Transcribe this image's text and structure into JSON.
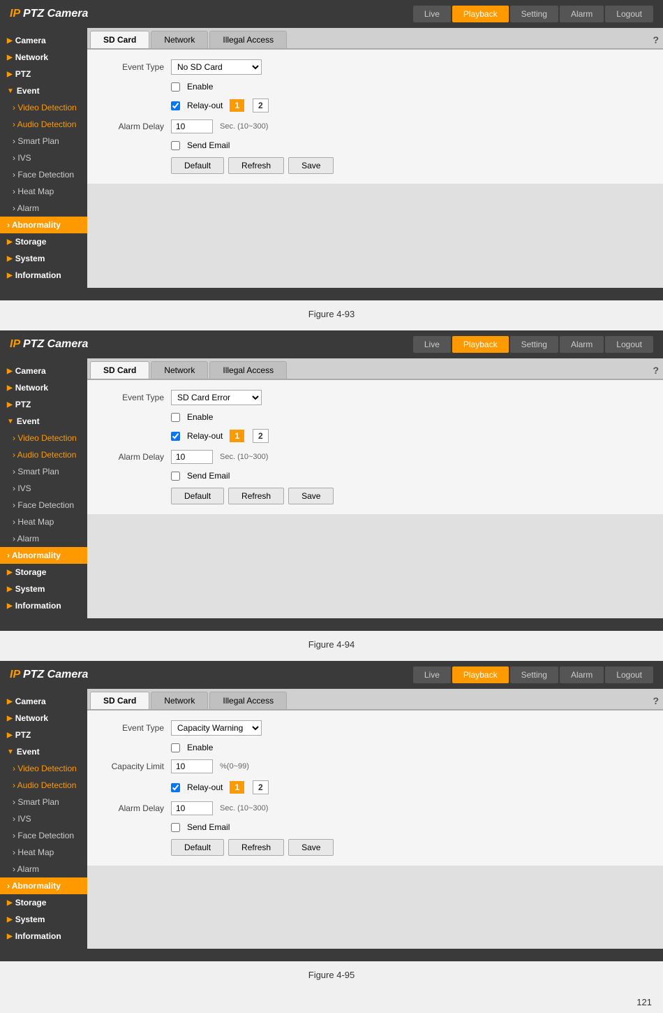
{
  "app": {
    "logo_ip": "IP",
    "logo_rest": " PTZ Camera"
  },
  "nav": {
    "buttons": [
      "Live",
      "Playback",
      "Setting",
      "Alarm",
      "Logout"
    ],
    "active": "Playback"
  },
  "sidebar": {
    "items": [
      {
        "label": "Camera",
        "type": "section"
      },
      {
        "label": "Network",
        "type": "section"
      },
      {
        "label": "PTZ",
        "type": "section"
      },
      {
        "label": "Event",
        "type": "section"
      },
      {
        "label": "Video Detection",
        "type": "sub"
      },
      {
        "label": "Audio Detection",
        "type": "sub"
      },
      {
        "label": "Smart Plan",
        "type": "sub"
      },
      {
        "label": "IVS",
        "type": "sub"
      },
      {
        "label": "Face Detection",
        "type": "sub"
      },
      {
        "label": "Heat Map",
        "type": "sub"
      },
      {
        "label": "Alarm",
        "type": "sub"
      },
      {
        "label": "Abnormality",
        "type": "sub",
        "active": true
      },
      {
        "label": "Storage",
        "type": "section"
      },
      {
        "label": "System",
        "type": "section"
      },
      {
        "label": "Information",
        "type": "section"
      }
    ]
  },
  "panels": [
    {
      "figure": "Figure 4-93",
      "tabs": [
        "SD Card",
        "Network",
        "Illegal Access"
      ],
      "active_tab": "SD Card",
      "fields": {
        "event_type": "No SD Card",
        "event_type_options": [
          "No SD Card",
          "SD Card Error",
          "Capacity Warning"
        ],
        "enable_checked": false,
        "relay_out_checked": true,
        "relay_btns": [
          "1",
          "2"
        ],
        "relay_active": "1",
        "alarm_delay": "10",
        "alarm_delay_hint": "Sec. (10~300)",
        "send_email_checked": false
      },
      "buttons": [
        "Default",
        "Refresh",
        "Save"
      ]
    },
    {
      "figure": "Figure 4-94",
      "tabs": [
        "SD Card",
        "Network",
        "Illegal Access"
      ],
      "active_tab": "SD Card",
      "fields": {
        "event_type": "SD Card Error",
        "event_type_options": [
          "No SD Card",
          "SD Card Error",
          "Capacity Warning"
        ],
        "enable_checked": false,
        "relay_out_checked": true,
        "relay_btns": [
          "1",
          "2"
        ],
        "relay_active": "1",
        "alarm_delay": "10",
        "alarm_delay_hint": "Sec. (10~300)",
        "send_email_checked": false
      },
      "buttons": [
        "Default",
        "Refresh",
        "Save"
      ]
    },
    {
      "figure": "Figure 4-95",
      "tabs": [
        "SD Card",
        "Network",
        "Illegal Access"
      ],
      "active_tab": "SD Card",
      "fields": {
        "event_type": "Capacity Warning",
        "event_type_options": [
          "No SD Card",
          "SD Card Error",
          "Capacity Warning"
        ],
        "enable_checked": false,
        "capacity_limit": "10",
        "capacity_hint": "%(0~99)",
        "relay_out_checked": true,
        "relay_btns": [
          "1",
          "2"
        ],
        "relay_active": "1",
        "alarm_delay": "10",
        "alarm_delay_hint": "Sec. (10~300)",
        "send_email_checked": false
      },
      "buttons": [
        "Default",
        "Refresh",
        "Save"
      ]
    }
  ],
  "labels": {
    "event_type": "Event Type",
    "enable": "Enable",
    "relay_out": "Relay-out",
    "alarm_delay": "Alarm Delay",
    "send_email": "Send Email",
    "capacity_limit": "Capacity Limit",
    "default": "Default",
    "refresh": "Refresh",
    "save": "Save",
    "help": "?"
  },
  "page_number": "121"
}
